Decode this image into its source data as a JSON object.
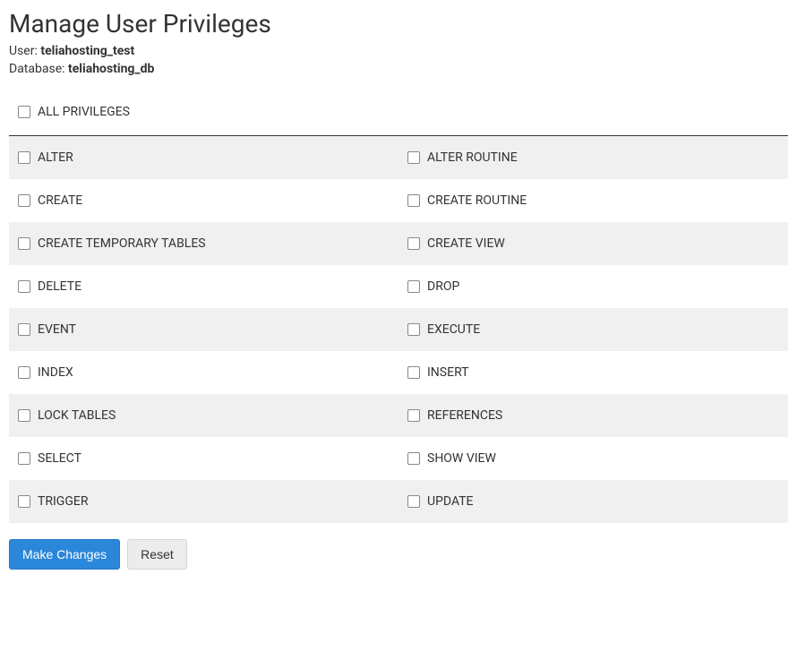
{
  "page_title": "Manage User Privileges",
  "user_label": "User: ",
  "user_value": "teliahosting_test",
  "database_label": "Database: ",
  "database_value": "teliahosting_db",
  "all_privileges_label": "ALL PRIVILEGES",
  "privileges": [
    {
      "left": "ALTER",
      "right": "ALTER ROUTINE"
    },
    {
      "left": "CREATE",
      "right": "CREATE ROUTINE"
    },
    {
      "left": "CREATE TEMPORARY TABLES",
      "right": "CREATE VIEW"
    },
    {
      "left": "DELETE",
      "right": "DROP"
    },
    {
      "left": "EVENT",
      "right": "EXECUTE"
    },
    {
      "left": "INDEX",
      "right": "INSERT"
    },
    {
      "left": "LOCK TABLES",
      "right": "REFERENCES"
    },
    {
      "left": "SELECT",
      "right": "SHOW VIEW"
    },
    {
      "left": "TRIGGER",
      "right": "UPDATE"
    }
  ],
  "buttons": {
    "make_changes": "Make Changes",
    "reset": "Reset"
  }
}
